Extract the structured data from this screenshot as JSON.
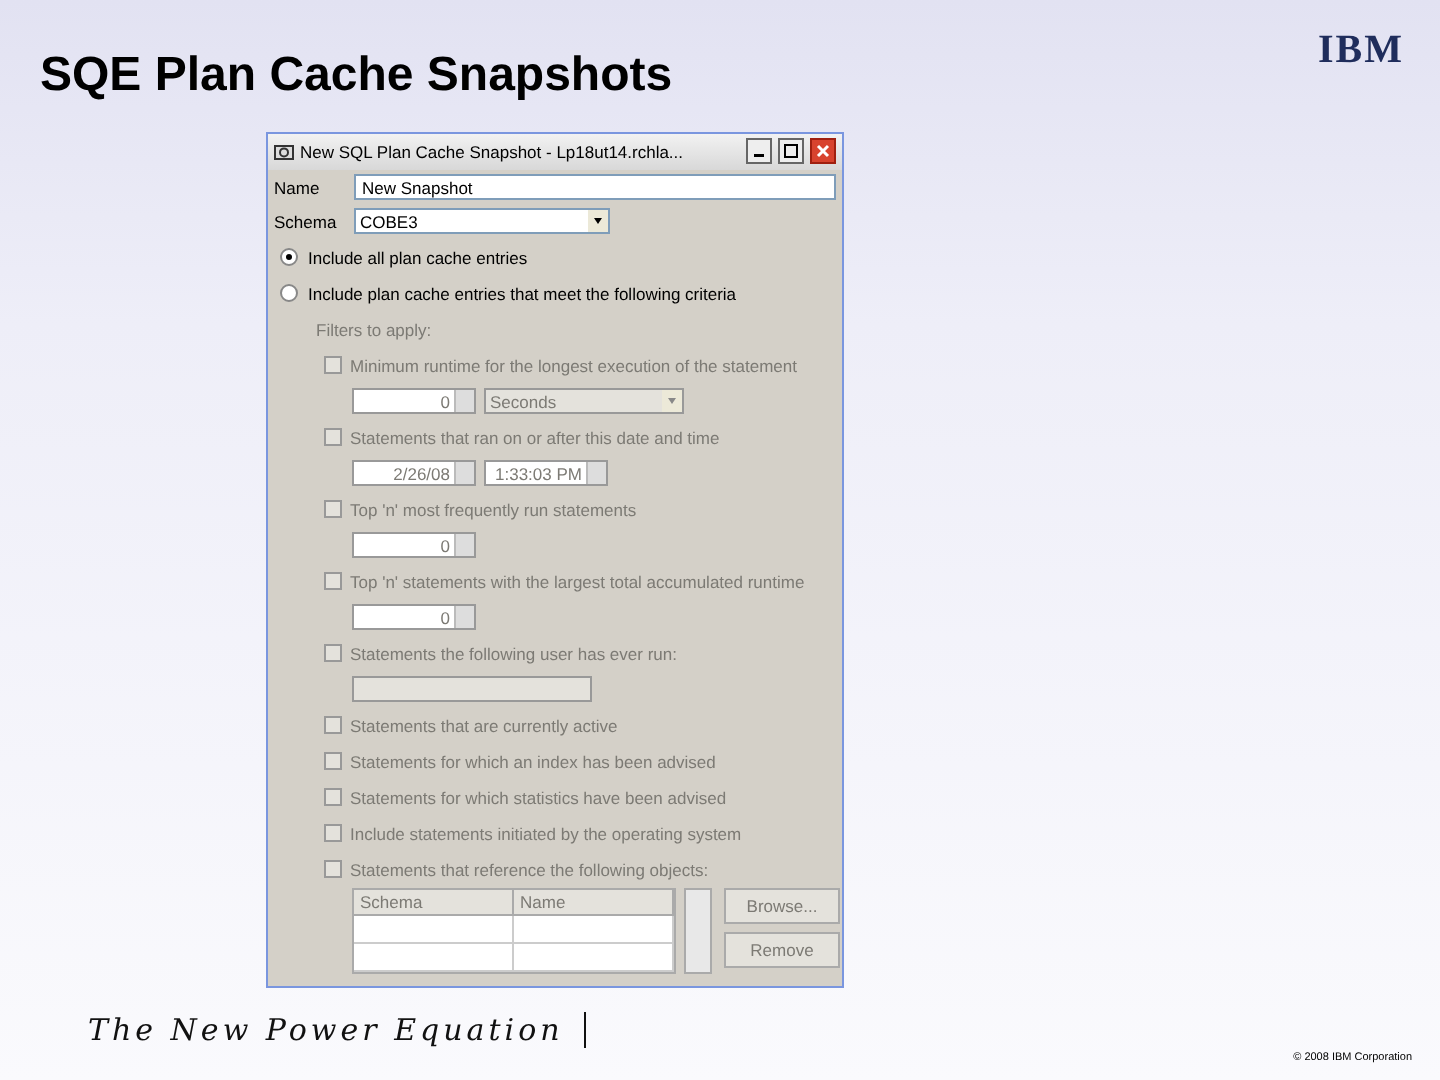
{
  "slide": {
    "title": "SQE Plan Cache Snapshots",
    "logo": "IBM",
    "tagline": "The New Power Equation",
    "footer": "© 2008 IBM Corporation"
  },
  "dialog": {
    "title": "New SQL Plan Cache Snapshot - Lp18ut14.rchla...",
    "name_field": {
      "label": "Name",
      "value": "New Snapshot"
    },
    "schema_field": {
      "label": "Schema",
      "value": "COBE3"
    },
    "radios": [
      {
        "label": "Include all plan cache entries",
        "selected": true
      },
      {
        "label": "Include plan cache entries that meet the following criteria",
        "selected": false
      }
    ],
    "filters_label": "Filters to apply:",
    "filters_disabled": true,
    "filters": [
      {
        "label": "Minimum runtime for the longest execution of the statement",
        "checked": false,
        "control": {
          "kind": "spin_unit",
          "value": "0",
          "unit": "Seconds"
        }
      },
      {
        "label": "Statements that ran on or after this date and time",
        "checked": false,
        "control": {
          "kind": "date_time",
          "date": "2/26/08",
          "time": "1:33:03 PM"
        }
      },
      {
        "label": "Top 'n' most frequently run statements",
        "checked": false,
        "control": {
          "kind": "spin",
          "value": "0"
        }
      },
      {
        "label": "Top 'n' statements with the largest total accumulated runtime",
        "checked": false,
        "control": {
          "kind": "spin",
          "value": "0"
        }
      },
      {
        "label": "Statements the following user has ever run:",
        "checked": false,
        "control": {
          "kind": "text"
        }
      },
      {
        "label": "Statements that are currently active",
        "checked": false
      },
      {
        "label": "Statements for which an index has been advised",
        "checked": false
      },
      {
        "label": "Statements for which statistics have been advised",
        "checked": false
      },
      {
        "label": "Include statements initiated by the operating system",
        "checked": false
      },
      {
        "label": "Statements that reference the following objects:",
        "checked": false
      }
    ],
    "objects_table": {
      "columns": [
        "Schema",
        "Name"
      ]
    },
    "buttons": [
      "Browse...",
      "Remove"
    ]
  }
}
